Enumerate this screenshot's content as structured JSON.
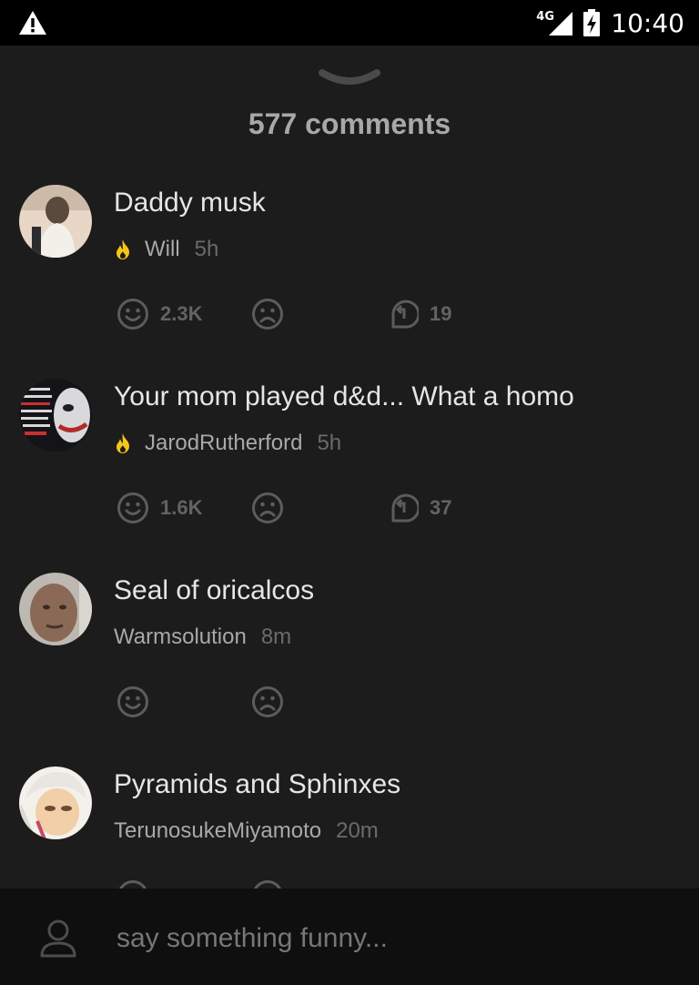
{
  "status_bar": {
    "time": "10:40",
    "network": "4G",
    "icons": [
      "warning-icon",
      "signal-icon",
      "battery-charging-icon"
    ]
  },
  "header": {
    "collapse_icon": "chevron-down-icon",
    "comments_count": "577 comments"
  },
  "comments": [
    {
      "text": "Daddy musk",
      "username": "Will",
      "time": "5h",
      "hot": true,
      "likes": "2.3K",
      "replies": "19"
    },
    {
      "text": "Your mom played d&d... What a homo",
      "username": "JarodRutherford",
      "time": "5h",
      "hot": true,
      "likes": "1.6K",
      "replies": "37"
    },
    {
      "text": "Seal of oricalcos",
      "username": "Warmsolution",
      "time": "8m",
      "hot": false,
      "likes": "",
      "replies": ""
    },
    {
      "text": "Pyramids and Sphinxes",
      "username": "TerunosukeMiyamoto",
      "time": "20m",
      "hot": false,
      "likes": "",
      "replies": ""
    }
  ],
  "input": {
    "placeholder": "say something funny...",
    "value": ""
  },
  "colors": {
    "background": "#1c1c1d",
    "bottom_bar": "#0f0f10",
    "fire": "#f5c518",
    "text": "#e6e6e6",
    "muted": "#636366"
  }
}
